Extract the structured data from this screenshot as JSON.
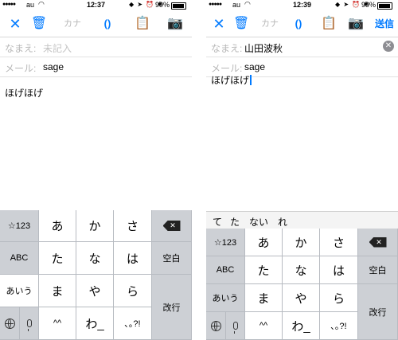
{
  "left": {
    "status": {
      "signal": "●●●●●",
      "carrier": "au",
      "time": "12:37",
      "system_icons": "◆ ➤ ⏰ ✱",
      "battery": "99%"
    },
    "toolbar": {
      "close": "✕",
      "trash": "🗑",
      "kana": "カナ",
      "paren": "()",
      "clipboard": "📋",
      "camera": "📷"
    },
    "name_label": "なまえ:",
    "name_value": "未記入",
    "mail_label": "メール:",
    "mail_value": "sage",
    "body_text": "ほげほげ",
    "keyboard": {
      "k123": "☆123",
      "a": "あ",
      "ka": "か",
      "sa": "さ",
      "abc": "ABC",
      "ta": "た",
      "na": "な",
      "ha": "は",
      "space": "空白",
      "aiu": "あいう",
      "ma": "ま",
      "ya": "や",
      "ra": "ら",
      "return": "改行",
      "face": "^^",
      "wa": "わ_",
      "punct": "､｡?!",
      "delete": "✕"
    }
  },
  "right": {
    "status": {
      "signal": "●●●●●",
      "carrier": "au",
      "time": "12:39",
      "system_icons": "◆ ➤ ⏰ ✱",
      "battery": "99%"
    },
    "toolbar": {
      "close": "✕",
      "trash": "🗑",
      "kana": "カナ",
      "paren": "()",
      "clipboard": "📋",
      "camera": "📷",
      "send": "送信"
    },
    "name_label": "なまえ:",
    "name_value": "山田波秋",
    "clear": "✕",
    "mail_label": "メール:",
    "mail_value": "sage",
    "body_text": "ほげほげ",
    "suggestions": [
      "て",
      "た",
      "ない",
      "れ"
    ],
    "keyboard": {
      "k123": "☆123",
      "a": "あ",
      "ka": "か",
      "sa": "さ",
      "abc": "ABC",
      "ta": "た",
      "na": "な",
      "ha": "は",
      "space": "空白",
      "aiu": "あいう",
      "ma": "ま",
      "ya": "や",
      "ra": "ら",
      "return": "改行",
      "face": "^^",
      "wa": "わ_",
      "punct": "､｡?!",
      "delete": "✕"
    }
  }
}
